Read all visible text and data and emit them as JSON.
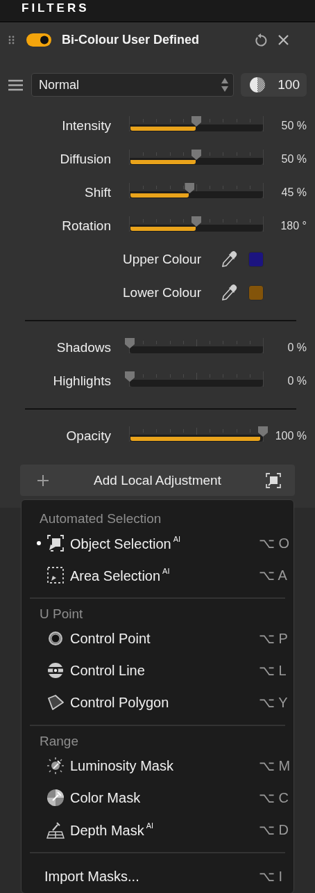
{
  "topbar": {
    "title": "FILTERS"
  },
  "filter": {
    "name": "Bi-Colour User Defined",
    "enabled": true
  },
  "blend": {
    "mode": "Normal",
    "opacity": "100"
  },
  "groups": [
    {
      "rows": [
        {
          "kind": "slider",
          "label": "Intensity",
          "level": 0.5,
          "reading": "50 %"
        },
        {
          "kind": "slider",
          "label": "Diffusion",
          "level": 0.5,
          "reading": "50 %"
        },
        {
          "kind": "slider",
          "label": "Shift",
          "level": 0.45,
          "reading": "45 %"
        },
        {
          "kind": "slider",
          "label": "Rotation",
          "level": 0.5,
          "reading": "180 °"
        },
        {
          "kind": "colour",
          "label": "Upper Colour",
          "color": "#1c1480"
        },
        {
          "kind": "colour",
          "label": "Lower Colour",
          "color": "#83540a"
        }
      ]
    },
    {
      "rows": [
        {
          "kind": "slider",
          "label": "Shadows",
          "level": 0,
          "reading": "0 %"
        },
        {
          "kind": "slider",
          "label": "Highlights",
          "level": 0,
          "reading": "0 %"
        }
      ]
    },
    {
      "rows": [
        {
          "kind": "slider",
          "label": "Opacity",
          "level": 1,
          "reading": "100 %"
        }
      ]
    }
  ],
  "add_button": {
    "label": "Add Local Adjustment"
  },
  "menu": {
    "sections": [
      {
        "heading": "Automated Selection",
        "items": [
          {
            "kind": "object",
            "label": "Object Selection$^{AI}$",
            "shortcut": "⌥ O",
            "selected": true
          },
          {
            "kind": "area",
            "label": "Area Selection$^{AI}$",
            "shortcut": "⌥ A",
            "selected": false
          }
        ]
      },
      {
        "heading": "U Point",
        "items": [
          {
            "kind": "point",
            "label": "Control Point",
            "shortcut": "⌥ P",
            "selected": false
          },
          {
            "kind": "line",
            "label": "Control Line",
            "shortcut": "⌥ L",
            "selected": false
          },
          {
            "kind": "polygon",
            "label": "Control Polygon",
            "shortcut": "⌥ Y",
            "selected": false
          }
        ]
      },
      {
        "heading": "Range",
        "items": [
          {
            "kind": "luminosity",
            "label": "Luminosity Mask",
            "shortcut": "⌥ M",
            "selected": false
          },
          {
            "kind": "color",
            "label": "Color Mask",
            "shortcut": "⌥ C",
            "selected": false
          },
          {
            "kind": "depth",
            "label": "Depth Mask$^{AI}$",
            "shortcut": "⌥ D",
            "selected": false
          }
        ]
      },
      {
        "items": [
          {
            "kind": "plain",
            "label": "Import Masks...",
            "shortcut": "⌥ I",
            "selected": false
          }
        ]
      }
    ]
  }
}
